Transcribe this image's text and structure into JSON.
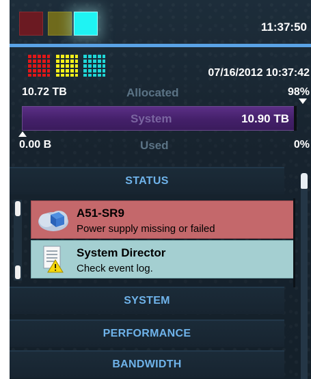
{
  "header": {
    "clock": "11:37:50",
    "indicators": [
      "red",
      "yellow",
      "cyan"
    ]
  },
  "capacity": {
    "timestamp": "07/16/2012 10:37:42",
    "allocated_value": "10.72 TB",
    "allocated_label": "Allocated",
    "allocated_percent": "98%",
    "bar_label": "System",
    "bar_value": "10.90 TB",
    "used_value": "0.00 B",
    "used_label": "Used",
    "used_percent": "0%"
  },
  "sections": {
    "status": "STATUS",
    "system": "SYSTEM",
    "performance": "PERFORMANCE",
    "bandwidth": "BANDWIDTH"
  },
  "status_items": [
    {
      "title": "A51-SR9",
      "message": "Power supply missing or failed",
      "severity": "error",
      "icon": "server-cloud-icon"
    },
    {
      "title": "System Director",
      "message": "Check event log.",
      "severity": "warning",
      "icon": "document-warning-icon"
    }
  ],
  "colors": {
    "accent": "#5aa3e6",
    "section_text": "#6fb3ea",
    "bar_fill": "#4a2372",
    "alert_bg": "#c4686b",
    "info_bg": "#a4cfd1"
  }
}
